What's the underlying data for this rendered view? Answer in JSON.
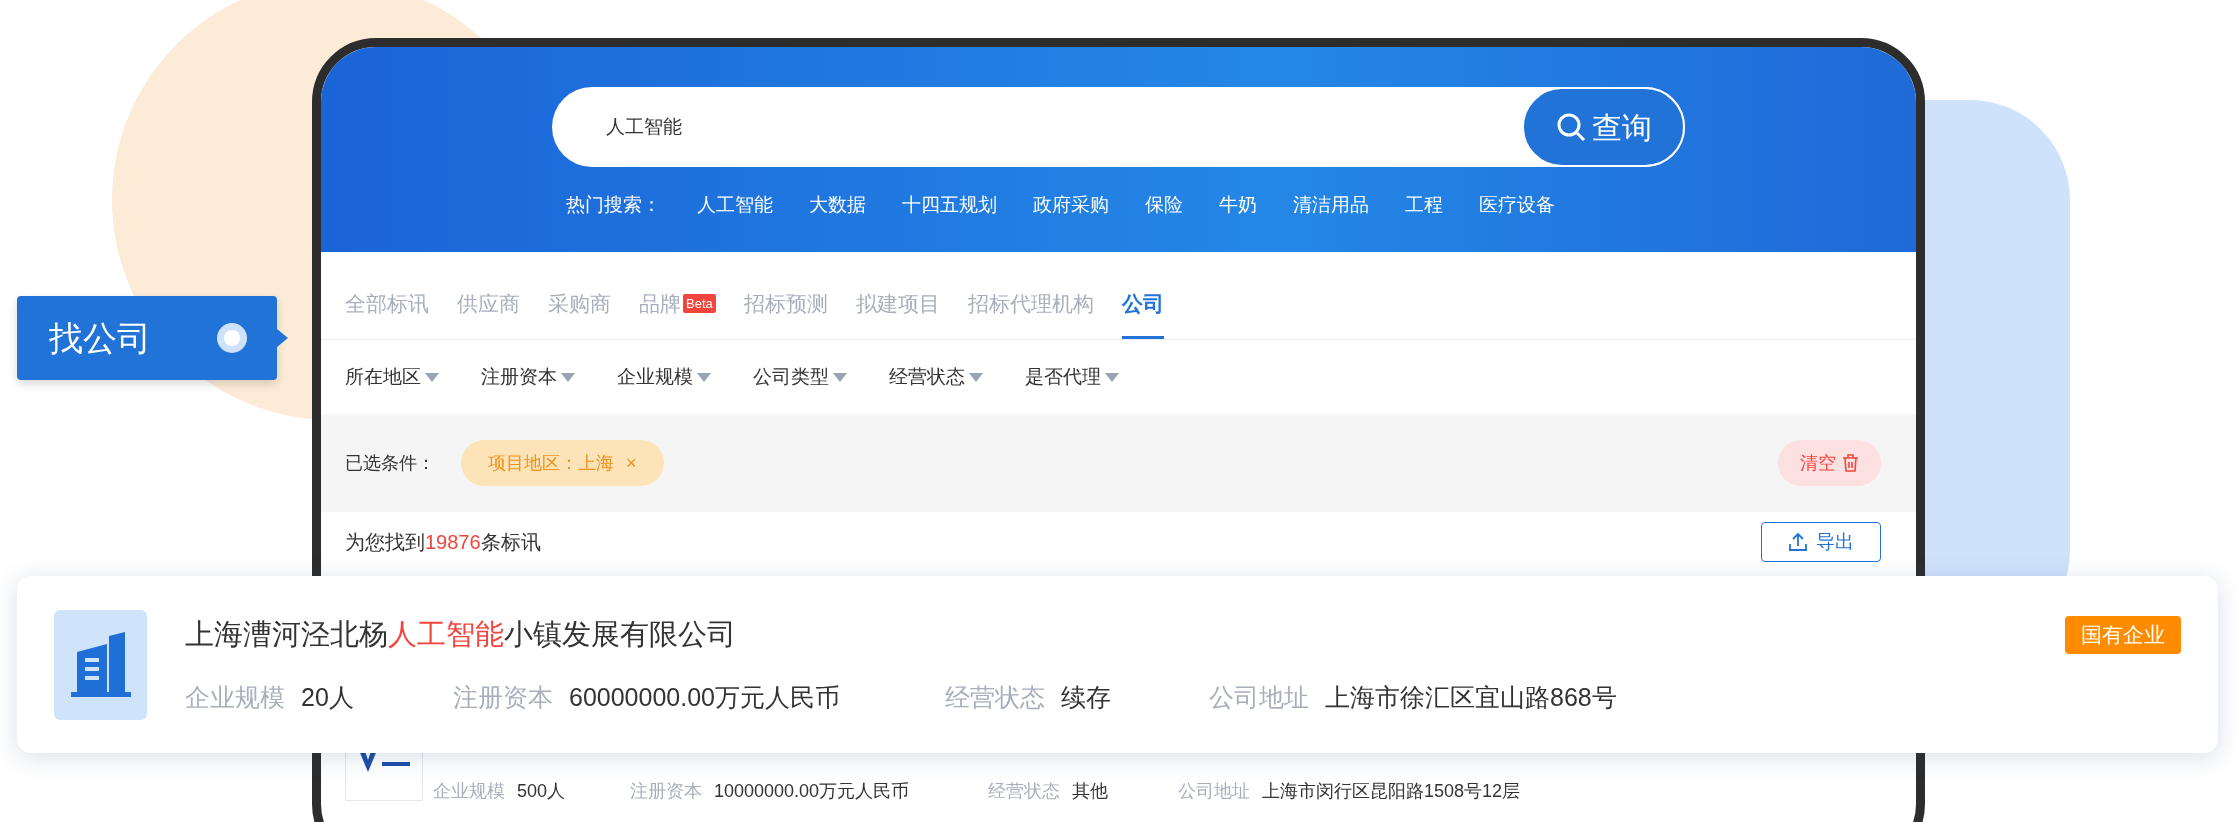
{
  "side_tag": {
    "label": "找公司",
    "active": true
  },
  "search": {
    "value": "人工智能",
    "button": "查询"
  },
  "hot_searches": {
    "label": "热门搜索：",
    "items": [
      "人工智能",
      "大数据",
      "十四五规划",
      "政府采购",
      "保险",
      "牛奶",
      "清洁用品",
      "工程",
      "医疗设备"
    ]
  },
  "tabs": [
    {
      "label": "全部标讯",
      "selected": false
    },
    {
      "label": "供应商",
      "selected": false
    },
    {
      "label": "采购商",
      "selected": false
    },
    {
      "label": "品牌",
      "badge": "Beta",
      "selected": false
    },
    {
      "label": "招标预测",
      "selected": false
    },
    {
      "label": "拟建项目",
      "selected": false
    },
    {
      "label": "招标代理机构",
      "selected": false
    },
    {
      "label": "公司",
      "selected": true
    }
  ],
  "filters": [
    "所在地区",
    "注册资本",
    "企业规模",
    "公司类型",
    "经营状态",
    "是否代理"
  ],
  "selected_conditions": {
    "label": "已选条件：",
    "chips": [
      {
        "label": "项目地区：上海",
        "remove": "×"
      }
    ],
    "clear": "清空"
  },
  "results": {
    "prefix": "为您找到",
    "count": "19876",
    "suffix": "条标讯",
    "export": "导出"
  },
  "companies": [
    {
      "kind": "featured",
      "name_before": "上海漕河泾北杨",
      "name_highlight": "人工智能",
      "name_after": "小镇发展有限公司",
      "badge": "国有企业",
      "fields": [
        {
          "label": "企业规模",
          "value": "20人"
        },
        {
          "label": "注册资本",
          "value": "60000000.00万元人民币"
        },
        {
          "label": "经营状态",
          "value": "续存"
        },
        {
          "label": "公司地址",
          "value": "上海市徐汇区宜山路868号"
        }
      ]
    },
    {
      "kind": "row",
      "fields": [
        {
          "label": "企业规模",
          "value": "500人"
        },
        {
          "label": "注册资本",
          "value": "10000000.00万元人民币"
        },
        {
          "label": "经营状态",
          "value": "其他"
        },
        {
          "label": "公司地址",
          "value": "上海市闵行区昆阳路1508号12层"
        }
      ]
    }
  ]
}
